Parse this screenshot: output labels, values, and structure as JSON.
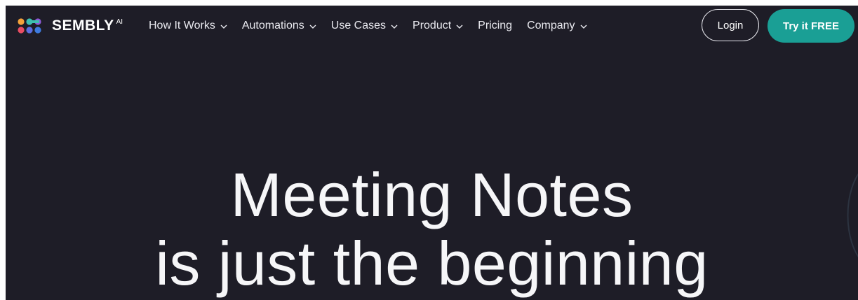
{
  "brand": {
    "name": "SEMBLY",
    "superscript": "AI",
    "logo_colors": [
      "#f5a33b",
      "#ea4d63",
      "#3dbfb0",
      "#5b6ee1",
      "#8e5bd8",
      "#3d7be0"
    ]
  },
  "nav": {
    "items": [
      {
        "label": "How It Works",
        "has_dropdown": true
      },
      {
        "label": "Automations",
        "has_dropdown": true
      },
      {
        "label": "Use Cases",
        "has_dropdown": true
      },
      {
        "label": "Product",
        "has_dropdown": true
      },
      {
        "label": "Pricing",
        "has_dropdown": false
      },
      {
        "label": "Company",
        "has_dropdown": true
      }
    ],
    "login_label": "Login",
    "cta_label": "Try it FREE"
  },
  "hero": {
    "line1": "Meeting Notes",
    "line2": "is just the beginning"
  },
  "colors": {
    "background": "#1e1d27",
    "cta": "#1a9f95",
    "text": "#ffffff"
  }
}
